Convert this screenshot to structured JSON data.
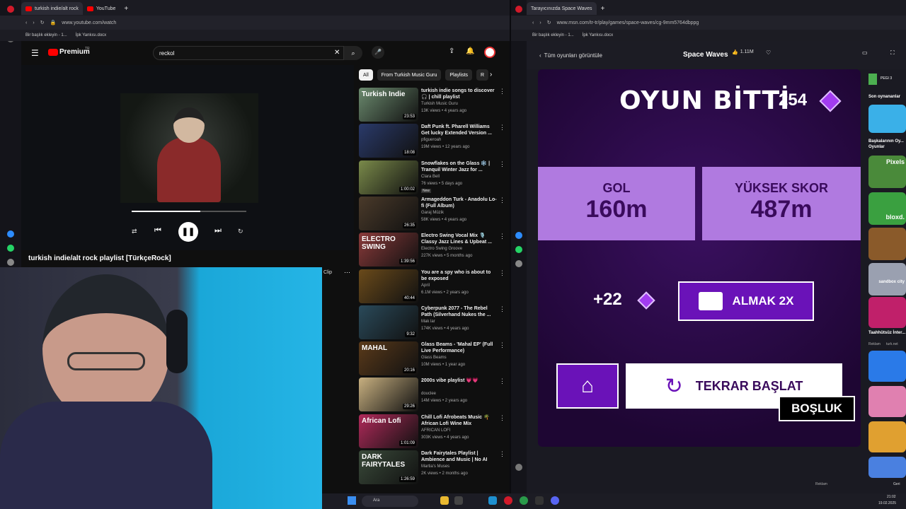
{
  "left_browser": {
    "tabs": [
      {
        "label": "turkish indie/alt rock"
      },
      {
        "label": "YouTube"
      }
    ],
    "url": "www.youtube.com/watch",
    "bookmarks": [
      "Bir başlık ekleyin - 1...",
      "İpk Yankısı.docx"
    ]
  },
  "youtube": {
    "logo_text": "Premium",
    "logo_sup": "TR",
    "search_value": "reckol",
    "video_title": "turkish indie/alt rock playlist [TürkçeRock]",
    "chips": [
      "All",
      "From Turkish Music Guru",
      "Playlists",
      "R"
    ],
    "clip_label": "Clip",
    "progress": 0.6,
    "recommended": [
      {
        "title": "turkish indie songs to discover 🎧 | chill playlist",
        "channel": "Turkish Music Guru",
        "meta": "13K views • 4 years ago",
        "duration": "23:53",
        "color": "#6b8a6e",
        "thumb_text": "Turkish Indie"
      },
      {
        "title": "Daft Punk ft. Pharell Williams Get lucky Extended Version ...",
        "channel": "pfigueroah",
        "meta": "19M views • 12 years ago",
        "duration": "18:08",
        "color": "#2a3a6a",
        "thumb_text": ""
      },
      {
        "title": "Snowflakes on the Glass ❄️ | Tranquil Winter Jazz for ...",
        "channel": "Clara Bell",
        "meta": "76 views • 5 days ago",
        "badge": "New",
        "duration": "1:00:02",
        "color": "#7a8a4a",
        "thumb_text": ""
      },
      {
        "title": "Armageddon Turk - Anadolu Lo-fi (Full Album)",
        "channel": "Garaj Müzik",
        "meta": "58K views • 4 years ago",
        "duration": "26:35",
        "color": "#4a3a2a",
        "thumb_text": ""
      },
      {
        "title": "Electro Swing Vocal Mix 🎙️ Classy Jazz Lines & Upbeat ...",
        "channel": "Electro Swing Groove",
        "meta": "227K views • 5 months ago",
        "duration": "1:39:56",
        "color": "#8a3a3a",
        "thumb_text": "ELECTRO SWING"
      },
      {
        "title": "You are a spy who is about to be exposed",
        "channel": "April",
        "meta": "6.1M views • 2 years ago",
        "duration": "40:44",
        "color": "#6a4a1a",
        "thumb_text": ""
      },
      {
        "title": "Cyberpunk 2077 - The Rebel Path (Silverhand Nukes the ...",
        "channel": "Mak lar",
        "meta": "174K views • 4 years ago",
        "duration": "9:32",
        "color": "#2a4a5a",
        "thumb_text": ""
      },
      {
        "title": "Glass Beams - 'Mahal EP' (Full Live Performance)",
        "channel": "Glass Beams",
        "meta": "10M views • 1 year ago",
        "duration": "20:16",
        "color": "#5a3a1a",
        "thumb_text": "MAHAL"
      },
      {
        "title": "2000s vibe playlist 💗💗",
        "channel": "douclee",
        "meta": "14M views • 2 years ago",
        "duration": "29:26",
        "color": "#c8b080",
        "thumb_text": ""
      },
      {
        "title": "Chill Lofi Afrobeats Music 🌴 African Lofi Wine Mix",
        "channel": "AFRICAN LOFI",
        "meta": "303K views • 4 years ago",
        "duration": "1:01:09",
        "color": "#b02a5a",
        "thumb_text": "African Lofi"
      },
      {
        "title": "Dark Fairytales Playlist | Ambience and Music | No AI",
        "channel": "Martia's Muses",
        "meta": "2K views • 2 months ago",
        "duration": "1:26:59",
        "color": "#3a4a3a",
        "thumb_text": "DARK FAIRYTALES"
      }
    ]
  },
  "right_browser": {
    "tab": "Tarayıcınızda Space Waves",
    "url": "www.msn.com/tr-tr/play/games/space-waves/cg-9mm5764dbppg",
    "bookmarks": [
      "Bir başlık ekleyin - 1...",
      "İpk Yankısı.docx"
    ],
    "back_label": "Tüm oyunları görüntüle",
    "game_name": "Space Waves",
    "likes": "1.11M"
  },
  "game": {
    "title": "OYUN BİTTİ",
    "score": "254",
    "gol_label": "GOL",
    "gol_value": "160m",
    "best_label": "YÜKSEK SKOR",
    "best_value": "487m",
    "bonus": "+22",
    "double_label": "ALMAK 2X",
    "restart_label": "TEKRAR BAŞLAT",
    "space_label": "BOŞLUK"
  },
  "msn_sidebar": {
    "pegi": "PEGI 3",
    "recent": "Son oynananlar",
    "others": "Başkalarının Oy... Oyunlar",
    "labels": [
      "Pixels",
      "bloxd.",
      "sandbox city"
    ],
    "sponsored": "Taahhütsüz İnter...",
    "ad": "Reklam",
    "ad_src": "turk.net",
    "bottom_ad": "Reklam",
    "geri": "Geri"
  },
  "taskbar": {
    "search": "Ara",
    "time": "21:02",
    "date": "19.02.2025"
  },
  "colors": {
    "yt_red": "#ff0000",
    "game_purple": "#6a12b8",
    "panel_lilac": "#b07ae0",
    "gem": "#a23cf0"
  }
}
